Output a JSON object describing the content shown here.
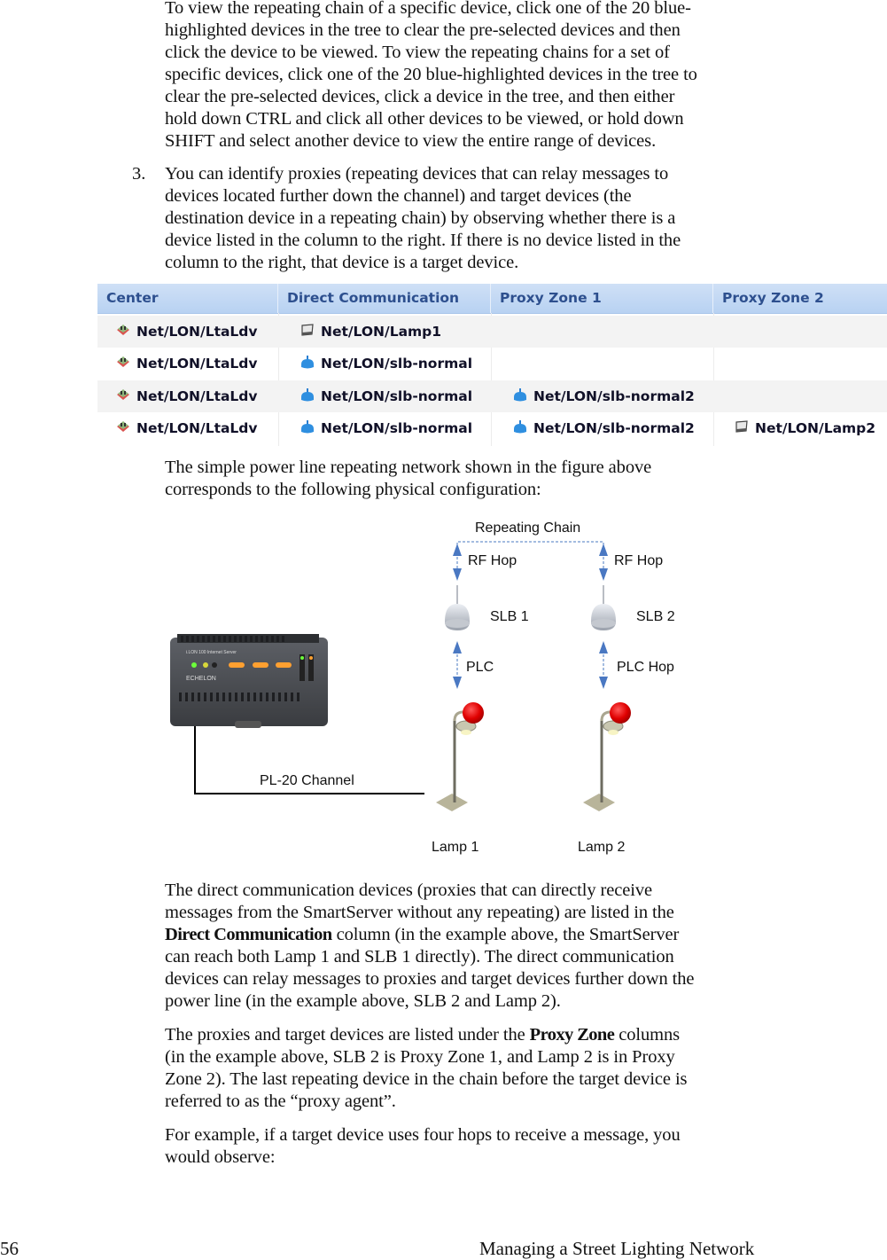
{
  "intro_paragraph": "To view the repeating chain of a specific device, click one of the 20 blue-highlighted devices in the tree to clear the pre-selected devices and then click the device to be viewed.  To view the repeating chains for a set of specific devices, click one of the 20 blue-highlighted devices in the tree to clear the pre-selected devices, click a device in the tree, and then either hold down CTRL and click all other devices to be viewed, or hold down SHIFT and select another device to view the entire range of devices.",
  "intro_lines": [
    "To view the repeating chain of a specific device, click one of the 20 blue-",
    "highlighted devices in the tree to clear the pre-selected devices and then",
    "click the device to be viewed.  To view the repeating chains for a set of",
    "specific devices, click one of the 20 blue-highlighted devices in the tree to",
    "clear the pre-selected devices, click a device in the tree, and then either",
    "hold down CTRL and click all other devices to be viewed, or hold down",
    "SHIFT and select another device to view the entire range of devices."
  ],
  "step3": {
    "number": "3.",
    "lines": [
      "You can identify proxies (repeating devices that can relay messages to",
      "devices located further down the channel) and target devices (the",
      "destination device in a repeating chain) by observing whether there is a",
      "device listed in the column to the right.  If there is no device listed in the",
      "column to the right, that device is a target device."
    ]
  },
  "table": {
    "headers": [
      "Center",
      "Direct Communication",
      "Proxy Zone 1",
      "Proxy Zone 2"
    ],
    "header_color": "#2d4f8e",
    "rows": [
      [
        {
          "icon": "smartserver-icon",
          "text": "Net/LON/LtaLdv"
        },
        {
          "icon": "lamp-controller-icon",
          "text": "Net/LON/Lamp1"
        },
        null,
        null
      ],
      [
        {
          "icon": "smartserver-icon",
          "text": "Net/LON/LtaLdv"
        },
        {
          "icon": "slb-icon",
          "text": "Net/LON/slb-normal"
        },
        null,
        null
      ],
      [
        {
          "icon": "smartserver-icon",
          "text": "Net/LON/LtaLdv"
        },
        {
          "icon": "slb-icon",
          "text": "Net/LON/slb-normal"
        },
        {
          "icon": "slb-icon",
          "text": "Net/LON/slb-normal2"
        },
        null
      ],
      [
        {
          "icon": "smartserver-icon",
          "text": "Net/LON/LtaLdv"
        },
        {
          "icon": "slb-icon",
          "text": "Net/LON/slb-normal"
        },
        {
          "icon": "slb-icon",
          "text": "Net/LON/slb-normal2"
        },
        {
          "icon": "lamp-controller-icon",
          "text": "Net/LON/Lamp2"
        }
      ]
    ]
  },
  "figure_caption_lines": [
    "The simple power line repeating network shown in the figure above",
    "corresponds to the following physical configuration:"
  ],
  "diagram": {
    "repeating_chain": "Repeating Chain",
    "rf_hop_1": "RF Hop",
    "rf_hop_2": "RF Hop",
    "slb1": "SLB 1",
    "slb2": "SLB 2",
    "plc": "PLC",
    "plc_hop": "PLC Hop",
    "channel": "PL-20 Channel",
    "lamp1": "Lamp 1",
    "lamp2": "Lamp 2",
    "device_brand": "ECHELON",
    "device_model": "i.LON 100  Internet Server",
    "arrow_color": "#4a78c2"
  },
  "para_direct_lines": [
    [
      "",
      "The direct communication devices (proxies that can directly receive"
    ],
    [
      "",
      "messages from the SmartServer without any repeating) are listed in the"
    ],
    [
      "Direct Communication",
      " column (in the example above, the SmartServer"
    ],
    [
      "",
      "can reach both Lamp 1 and SLB 1 directly).  The direct communication"
    ],
    [
      "",
      "devices can relay messages to proxies and target devices further down the"
    ],
    [
      "",
      "power line (in the example above, SLB 2 and Lamp 2)."
    ]
  ],
  "para_proxy_lines": [
    [
      "The proxies and target devices are listed under the ",
      "Proxy Zone",
      " columns"
    ],
    [
      "(in the example above, SLB 2 is Proxy Zone 1, and Lamp 2 is in Proxy",
      "",
      ""
    ],
    [
      "Zone 2).  The last repeating device in the chain before the target device is",
      "",
      ""
    ],
    [
      "referred to as the “proxy agent”.",
      "",
      ""
    ]
  ],
  "para_example_lines": [
    "For example, if a target device uses four hops to receive a message, you",
    "would observe:"
  ],
  "footer": {
    "page_number": "56",
    "chapter_title": "Managing a Street Lighting Network"
  }
}
